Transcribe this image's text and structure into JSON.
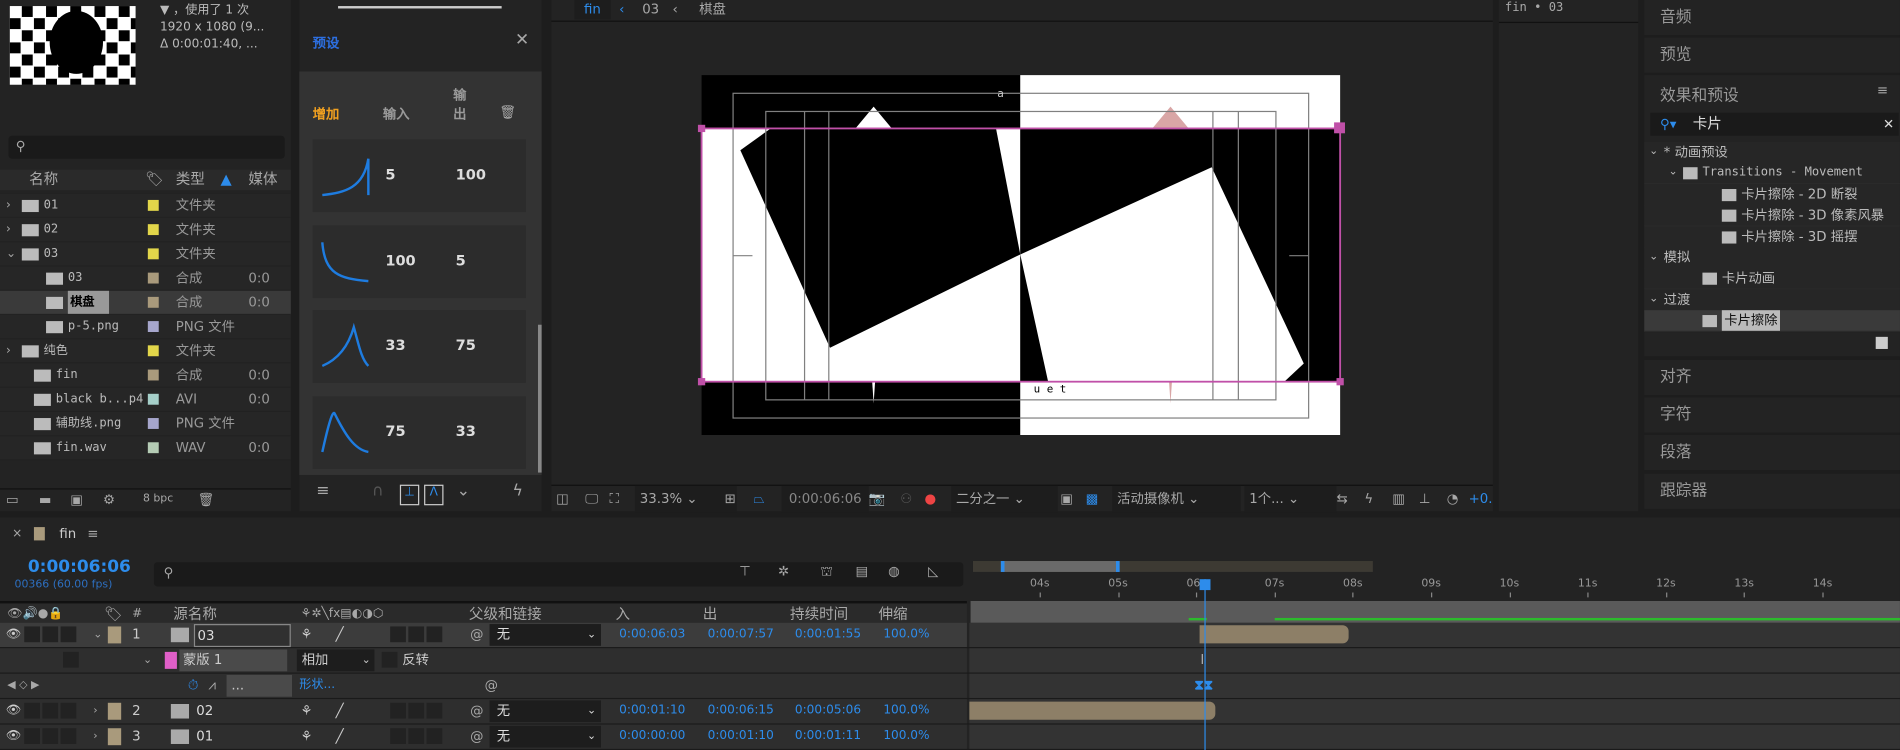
{
  "project": {
    "info_line1": "▼ ，使用了 1 次",
    "info_line2": "1920 x 1080 (9...",
    "info_line3": "Δ 0:00:01:40, ...",
    "columns": [
      "名称",
      "类型",
      "媒体"
    ],
    "items": [
      {
        "name": "01",
        "type": "文件夹",
        "dur": "",
        "color": "#e2d64a",
        "icon": "folder-icon",
        "expander": "›",
        "indent": 0
      },
      {
        "name": "02",
        "type": "文件夹",
        "dur": "",
        "color": "#e2d64a",
        "icon": "folder-icon",
        "expander": "›",
        "indent": 0
      },
      {
        "name": "03",
        "type": "文件夹",
        "dur": "",
        "color": "#e2d64a",
        "icon": "folder-icon",
        "expander": "⌄",
        "indent": 0
      },
      {
        "name": "03",
        "type": "合成",
        "dur": "0:0",
        "color": "#a99a7c",
        "icon": "composition-icon",
        "expander": "",
        "indent": 2
      },
      {
        "name": "棋盘",
        "type": "合成",
        "dur": "0:0",
        "color": "#a99a7c",
        "icon": "composition-icon",
        "expander": "",
        "indent": 2,
        "selected": true
      },
      {
        "name": "p-5.png",
        "type": "PNG 文件",
        "dur": "",
        "color": "#a6a6cc",
        "icon": "image-file-icon",
        "expander": "",
        "indent": 2
      },
      {
        "name": "纯色",
        "type": "文件夹",
        "dur": "",
        "color": "#e2d64a",
        "icon": "folder-icon",
        "expander": "›",
        "indent": 0
      },
      {
        "name": "fin",
        "type": "合成",
        "dur": "0:0",
        "color": "#a99a7c",
        "icon": "composition-icon",
        "expander": "",
        "indent": 1
      },
      {
        "name": "black b...p4",
        "type": "AVI",
        "dur": "0:0",
        "color": "#a5cfc9",
        "icon": "video-file-icon",
        "expander": "",
        "indent": 1
      },
      {
        "name": "辅助线.png",
        "type": "PNG 文件",
        "dur": "",
        "color": "#a6a6cc",
        "icon": "image-file-icon",
        "expander": "",
        "indent": 1
      },
      {
        "name": "fin.wav",
        "type": "WAV",
        "dur": "0:0",
        "color": "#b5ccb5",
        "icon": "audio-file-icon",
        "expander": "",
        "indent": 1
      }
    ],
    "bpc": "8 bpc"
  },
  "presets": {
    "title": "预设",
    "add": "增加",
    "col_in": "输入",
    "col_out": "输\n出",
    "cards": [
      {
        "in": "5",
        "out": "100"
      },
      {
        "in": "100",
        "out": "5"
      },
      {
        "in": "33",
        "out": "75"
      },
      {
        "in": "75",
        "out": "33"
      }
    ]
  },
  "viewer": {
    "breadcrumb": [
      "fin",
      "03",
      "棋盘"
    ],
    "overlay_top": "a",
    "overlay_bottom": "u e t",
    "zoom": "33.3%",
    "timecode": "0:00:06:06",
    "resolution": "二分之一",
    "camera": "活动摄像机",
    "views": "1个...",
    "exposure": "+0."
  },
  "flow": {
    "title": "fin • 03"
  },
  "right": {
    "audio": "音频",
    "preview": "预览",
    "effects": "效果和预设",
    "search": "卡片",
    "tree": [
      {
        "label": "* 动画预设",
        "indent": 4,
        "icon": "",
        "exp": "⌄"
      },
      {
        "label": "Transitions - Movement",
        "indent": 20,
        "icon": "folder-icon",
        "exp": "⌄",
        "mono": true
      },
      {
        "label": "卡片擦除 - 2D 断裂",
        "indent": 52,
        "icon": "preset-fx-icon",
        "exp": ""
      },
      {
        "label": "卡片擦除 - 3D 像素风暴",
        "indent": 52,
        "icon": "preset-fx-icon",
        "exp": ""
      },
      {
        "label": "卡片擦除 - 3D 摇摆",
        "indent": 52,
        "icon": "preset-fx-icon",
        "exp": ""
      },
      {
        "label": "模拟",
        "indent": 4,
        "icon": "",
        "exp": "⌄"
      },
      {
        "label": "卡片动画",
        "indent": 36,
        "icon": "effect-plugin-icon",
        "exp": ""
      },
      {
        "label": "过渡",
        "indent": 4,
        "icon": "",
        "exp": "⌄"
      },
      {
        "label": "卡片擦除",
        "indent": 36,
        "icon": "effect-plugin-icon",
        "exp": "",
        "selected": true
      }
    ],
    "align": "对齐",
    "character": "字符",
    "paragraph": "段落",
    "tracker": "跟踪器"
  },
  "timeline": {
    "tab": "fin",
    "timecode": "0:00:06:06",
    "frames": "00366 (60.00 fps)",
    "headers": {
      "source": "源名称",
      "parent": "父级和链接",
      "in": "入",
      "out": "出",
      "duration": "持续时间",
      "stretch": "伸缩",
      "num": "#"
    },
    "layers": [
      {
        "num": "1",
        "name": "03",
        "parent": "无",
        "in": "0:00:06:03",
        "out": "0:00:07:57",
        "dur": "0:00:01:55",
        "stretch": "100.0%",
        "bar_start": 6.05,
        "bar_end": 7.95,
        "expanded": true
      },
      {
        "num": "2",
        "name": "02",
        "parent": "无",
        "in": "0:00:01:10",
        "out": "0:00:06:15",
        "dur": "0:00:05:06",
        "stretch": "100.0%",
        "bar_start": 1.17,
        "bar_end": 6.25
      },
      {
        "num": "3",
        "name": "01",
        "parent": "无",
        "in": "0:00:00:00",
        "out": "0:00:01:10",
        "dur": "0:00:01:11",
        "stretch": "100.0%",
        "bar_start": 0,
        "bar_end": 1.17
      }
    ],
    "mask": {
      "name": "蒙版 1",
      "mode": "相加",
      "invert": "反转",
      "shape": "形状...",
      "dots": "..."
    },
    "ruler": [
      "04s",
      "05s",
      "06",
      "07s",
      "08s",
      "09s",
      "10s",
      "11s",
      "12s",
      "13s",
      "14s"
    ],
    "current_time_s": 6.1,
    "colors": {
      "accent": "#2d8ceb",
      "mask": "#e05fc8",
      "layer": "#a99a7c"
    }
  }
}
